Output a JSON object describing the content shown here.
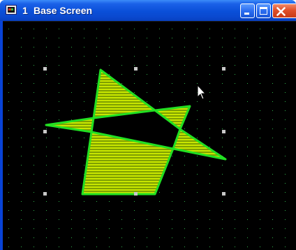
{
  "window": {
    "number": "1",
    "title": "Base Screen",
    "buttons": {
      "minimize": "minimize-icon",
      "maximize": "maximize-icon",
      "close": "close-icon"
    }
  },
  "canvas": {
    "background": "#000000",
    "grid_dot_color": "#2fae4a",
    "handle_color": "#c8c8c8",
    "shape_fill": "#c8e600",
    "shape_stroke": "#22e022"
  }
}
